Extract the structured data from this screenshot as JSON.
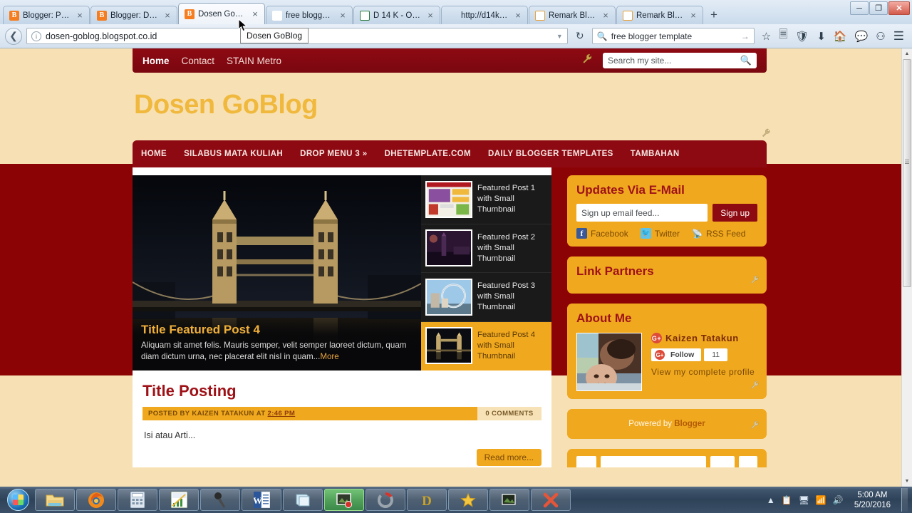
{
  "browser": {
    "tabs": [
      {
        "title": "Blogger: Perso...",
        "favicon": "blogger-icon",
        "active": false
      },
      {
        "title": "Blogger: Dose...",
        "favicon": "blogger-icon",
        "active": false
      },
      {
        "title": "Dosen GoBlog",
        "favicon": "blogger-icon",
        "active": true
      },
      {
        "title": "free blogger te...",
        "favicon": "google-icon",
        "active": false
      },
      {
        "title": "D 14 K - ONLINE",
        "favicon": "document-icon",
        "active": false
      },
      {
        "title": "http://d14k.blogsp...",
        "favicon": "none-icon",
        "active": false
      },
      {
        "title": "Remark Blogg...",
        "favicon": "dletter-icon",
        "active": false
      },
      {
        "title": "Remark Blogg...",
        "favicon": "dletter-icon",
        "active": false
      }
    ],
    "new_tab_label": "+",
    "close_tab_label": "×",
    "window_controls": {
      "minimize": "─",
      "restore": "❐",
      "close": "✕"
    },
    "url": "dosen-goblog.blogspot.co.id",
    "search_value": "free blogger template",
    "tooltip": "Dosen GoBlog",
    "back_icon": "back-arrow-icon",
    "reload_icon": "reload-icon",
    "toolbar_icons": [
      "star-icon",
      "reading-list-icon",
      "pocket-icon",
      "download-icon",
      "home-icon",
      "chat-icon",
      "sync-icon",
      "menu-icon"
    ]
  },
  "site": {
    "topbar": {
      "links": [
        "Home",
        "Contact",
        "STAIN Metro"
      ],
      "search_placeholder": "Search my site...",
      "wrench": "wrench-icon"
    },
    "title": "Dosen GoBlog",
    "mainnav": [
      "HOME",
      "SILABUS MATA KULIAH",
      "DROP MENU 3 »",
      "DHETEMPLATE.COM",
      "DAILY BLOGGER TEMPLATES",
      "TAMBAHAN"
    ]
  },
  "slider": {
    "featured_title": "Title Featured Post 4",
    "featured_text": "Aliquam sit amet felis. Mauris semper, velit semper laoreet dictum, quam diam dictum urna, nec placerat elit nisl in quam...",
    "more_label": "More",
    "thumbs": [
      {
        "label": "Featured Post 1 with Small Thumbnail",
        "active": false
      },
      {
        "label": "Featured Post 2 with Small Thumbnail",
        "active": false
      },
      {
        "label": "Featured Post 3 with Small Thumbnail",
        "active": false
      },
      {
        "label": "Featured Post 4 with Small Thumbnail",
        "active": true
      }
    ]
  },
  "post": {
    "title": "Title Posting",
    "meta_prefix": "POSTED BY KAIZEN TATAKUN",
    "meta_at": "AT",
    "meta_time": "2:46 PM",
    "comments": "0 COMMENTS",
    "body": "Isi atau Arti...",
    "read_more": "Read more..."
  },
  "sidebar": {
    "updates": {
      "title": "Updates Via E-Mail",
      "input_placeholder": "Sign up email feed...",
      "button": "Sign up",
      "social": [
        {
          "label": "Facebook",
          "icon": "facebook-icon"
        },
        {
          "label": "Twitter",
          "icon": "twitter-icon"
        },
        {
          "label": "RSS Feed",
          "icon": "rss-icon"
        }
      ]
    },
    "link_partners": {
      "title": "Link Partners"
    },
    "about": {
      "title": "About Me",
      "name": "Kaizen Tatakun",
      "follow_label": "Follow",
      "follow_count": "11",
      "profile_link": "View my complete profile"
    },
    "powered": {
      "prefix": "Powered by ",
      "brand": "Blogger"
    }
  },
  "taskbar": {
    "items": [
      "explorer-icon",
      "firefox-icon",
      "calculator-icon",
      "chart-icon",
      "microphone-icon",
      "word-icon",
      "notebook-icon",
      "photo-icon",
      "loader-icon",
      "dreamweaver-icon",
      "star-icon",
      "paint-icon",
      "xnview-icon"
    ],
    "tray_icons": [
      "show-hidden-icon",
      "security-icon",
      "network-action-icon",
      "signal-icon",
      "volume-icon"
    ],
    "time": "5:00 AM",
    "date": "5/20/2016"
  },
  "colors": {
    "dark_red": "#8e0a12",
    "stripe_red": "#8c0306",
    "gold": "#f0a81e",
    "cream": "#f7e1b4",
    "title_gold": "#f0b93e"
  }
}
